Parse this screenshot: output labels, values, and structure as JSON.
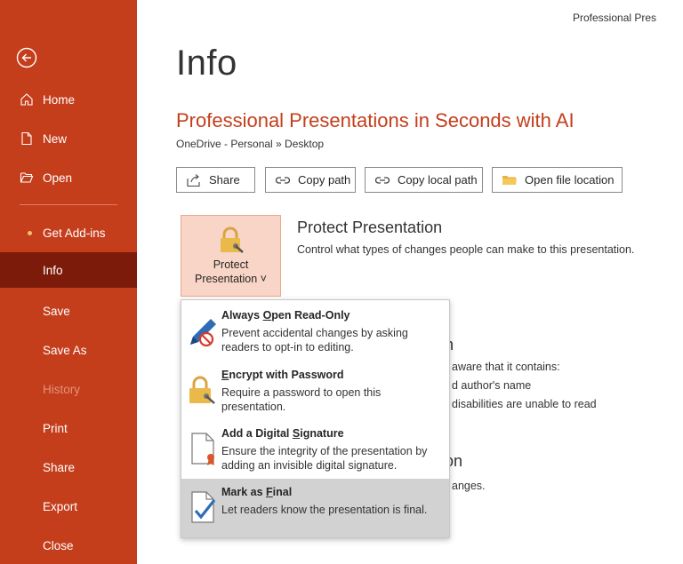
{
  "window": {
    "title_truncated": "Professional Pres"
  },
  "sidebar": {
    "items": [
      {
        "id": "home",
        "label": "Home",
        "icon": "home-icon"
      },
      {
        "id": "new",
        "label": "New",
        "icon": "new-document-icon"
      },
      {
        "id": "open",
        "label": "Open",
        "icon": "folder-open-icon"
      },
      {
        "id": "addins",
        "label": "Get Add-ins"
      },
      {
        "id": "info",
        "label": "Info",
        "active": true
      },
      {
        "id": "save",
        "label": "Save"
      },
      {
        "id": "saveas",
        "label": "Save As"
      },
      {
        "id": "history",
        "label": "History",
        "disabled": true
      },
      {
        "id": "print",
        "label": "Print"
      },
      {
        "id": "share",
        "label": "Share"
      },
      {
        "id": "export",
        "label": "Export"
      },
      {
        "id": "close",
        "label": "Close"
      }
    ]
  },
  "main": {
    "page_title": "Info",
    "doc_title": "Professional Presentations in Seconds with AI",
    "breadcrumb": "OneDrive - Personal » Desktop",
    "buttons": {
      "share": "Share",
      "copy_path": "Copy path",
      "copy_local_path": "Copy local path",
      "open_location": "Open file location"
    },
    "protect": {
      "tile_line1": "Protect",
      "tile_line2": "Presentation ˅",
      "title": "Protect Presentation",
      "description": "Control what types of changes people can make to this presentation."
    },
    "inspect_partial": {
      "heading_tail": "n",
      "line1": "aware that it contains:",
      "line2": "d author's name",
      "line3": "disabilities are unable to read"
    },
    "versions_partial": {
      "heading_tail": "on",
      "line1": "anges."
    }
  },
  "dropdown": {
    "items": [
      {
        "title_pre": "Always ",
        "title_key": "O",
        "title_post": "pen Read-Only",
        "desc": "Prevent accidental changes by asking readers to opt-in to editing.",
        "icon": "pencil-no-edit-icon"
      },
      {
        "title_pre": "",
        "title_key": "E",
        "title_post": "ncrypt with Password",
        "desc": "Require a password to open this presentation.",
        "icon": "lock-key-icon"
      },
      {
        "title_pre": "Add a Digital ",
        "title_key": "S",
        "title_post": "ignature",
        "desc": "Ensure the integrity of the presentation by adding an invisible digital signature.",
        "icon": "digital-signature-icon"
      },
      {
        "title_pre": "Mark as ",
        "title_key": "F",
        "title_post": "inal",
        "desc": "Let readers know the presentation is final.",
        "icon": "mark-final-icon",
        "highlighted": true
      }
    ]
  },
  "colors": {
    "sidebar": "#c43e1c",
    "sidebar_active": "#7d1b0a",
    "accent_text": "#c43e1c",
    "tile_bg": "#f8d5c6",
    "menu_highlight": "#d2d2d2"
  }
}
